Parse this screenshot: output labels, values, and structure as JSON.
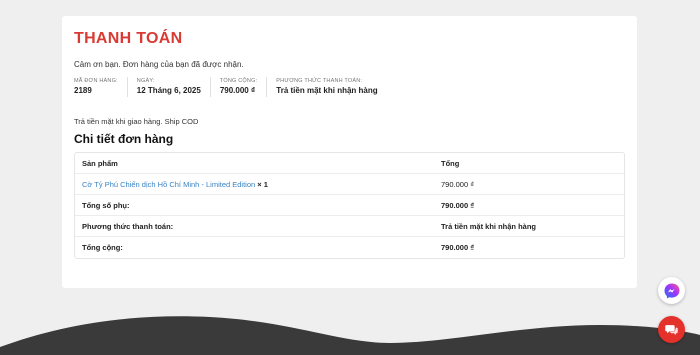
{
  "page": {
    "title": "THANH TOÁN",
    "thanks_message": "Cảm ơn bạn. Đơn hàng của bạn đã được nhận.",
    "payment_note": "Trả tiền mặt khi giao hàng. Ship COD"
  },
  "overview": [
    {
      "label": "MÃ ĐƠN HÀNG:",
      "value": "2189"
    },
    {
      "label": "NGÀY:",
      "value": "12 Tháng 6, 2025"
    },
    {
      "label": "TỔNG CỘNG:",
      "value": "790.000 ₫"
    },
    {
      "label": "PHƯƠNG THỨC THANH TOÁN:",
      "value": "Trả tiền mặt khi nhận hàng"
    }
  ],
  "details": {
    "title": "Chi tiết đơn hàng",
    "header": {
      "product": "Sản phẩm",
      "total": "Tổng"
    },
    "item": {
      "name": "Cờ Tỷ Phú Chiến dịch Hồ Chí Minh - Limited Edition",
      "qty": "× 1",
      "total": "790.000 ₫"
    },
    "subtotal": {
      "label": "Tổng số phụ:",
      "value": "790.000 ₫"
    },
    "payment_method": {
      "label": "Phương thức thanh toán:",
      "value": "Trả tiền mặt khi nhận hàng"
    },
    "grand_total": {
      "label": "Tổng cộng:",
      "value": "790.000 ₫"
    }
  },
  "floating": {
    "messenger_icon": "messenger-icon",
    "chat_icon": "chat-icon"
  },
  "colors": {
    "title": "#d93a34",
    "link": "#3b84c4",
    "chat_button": "#e4312b",
    "wave": "#3a3a3a"
  }
}
